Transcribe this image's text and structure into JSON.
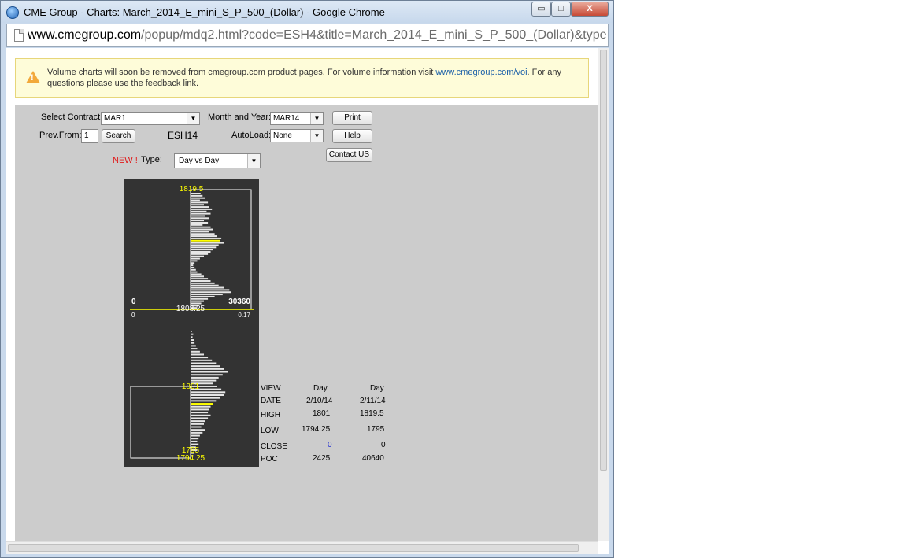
{
  "window": {
    "title": "CME Group - Charts: March_2014_E_mini_S_P_500_(Dollar) - Google Chrome",
    "min_glyph": "▭",
    "max_glyph": "□",
    "close_glyph": "X"
  },
  "address": {
    "host": "www.cmegroup.com",
    "path": "/popup/mdq2.html?code=ESH4&title=March_2014_E_mini_S_P_500_(Dollar)&type="
  },
  "notice": {
    "text_before": "Volume charts will soon be removed from cmegroup.com product pages. For volume information visit ",
    "link": "www.cmegroup.com/voi",
    "text_after": ". For any questions please use the feedback link."
  },
  "controls": {
    "select_contract_label": "Select Contract:",
    "select_contract_value": "MAR1",
    "month_year_label": "Month and Year:",
    "month_year_value": "MAR14",
    "print_label": "Print",
    "prevfrom_label": "Prev.From:",
    "prevfrom_value": "1",
    "search_label": "Search",
    "code_text": "ESH14",
    "autoload_label": "AutoLoad:",
    "autoload_value": "None",
    "help_label": "Help",
    "contact_label": "Contact US",
    "new_label": "NEW !",
    "type_label": "Type:",
    "type_value": "Day vs Day"
  },
  "chart_data": {
    "type": "bar",
    "orientation": "horizontal",
    "description_source": "volume profile, two sessions stacked",
    "colors": {
      "background": "#333333",
      "bars": "#e6e6e6",
      "poc": "#ffff00",
      "box": "#ffffff",
      "price_label": "#ffff00",
      "axis_text": "#ffffff"
    },
    "max_volume": 30360,
    "upper_profile": {
      "high": "1819.5",
      "low": "1808.25",
      "bars": [
        0.15,
        0.18,
        0.22,
        0.14,
        0.26,
        0.2,
        0.28,
        0.32,
        0.24,
        0.3,
        0.22,
        0.28,
        0.2,
        0.26,
        0.18,
        0.3,
        0.34,
        0.28,
        0.36,
        0.4,
        0.46,
        0.44,
        0.5,
        0.42,
        0.38,
        0.34,
        0.3,
        0.26,
        0.2,
        0.14,
        0.1,
        0.06,
        0.04,
        0.06,
        0.08,
        0.1,
        0.16,
        0.2,
        0.26,
        0.3,
        0.36,
        0.42,
        0.5,
        0.58,
        0.6,
        0.48,
        0.36,
        0.26,
        0.2,
        0.16,
        0.12,
        0.1
      ],
      "poc_index": 21
    },
    "lower_profile": {
      "high": "1801",
      "low_a": "1795",
      "low_b": "1794.25",
      "bars": [
        0.02,
        0.04,
        0.03,
        0.05,
        0.06,
        0.08,
        0.1,
        0.14,
        0.2,
        0.26,
        0.32,
        0.38,
        0.44,
        0.5,
        0.56,
        0.48,
        0.42,
        0.38,
        0.34,
        0.4,
        0.46,
        0.52,
        0.5,
        0.44,
        0.38,
        0.34,
        0.3,
        0.28,
        0.26,
        0.3,
        0.26,
        0.22,
        0.2,
        0.16,
        0.22,
        0.18,
        0.14,
        0.12,
        0.1,
        0.12,
        0.08,
        0.1,
        0.06,
        0.04
      ],
      "poc_index": 25
    },
    "axis": {
      "left_volume": "0",
      "right_volume": "30360",
      "left_pct": "0",
      "right_pct": "0.17",
      "middle_price": "1808.25"
    }
  },
  "stats": {
    "headers": [
      "VIEW",
      "Day",
      "Day"
    ],
    "rows": [
      {
        "label": "DATE",
        "a": "2/10/14",
        "b": "2/11/14"
      },
      {
        "label": "HIGH",
        "a": "1801",
        "b": "1819.5"
      },
      {
        "label": "LOW",
        "a": "1794.25",
        "b": "1795"
      },
      {
        "label": "CLOSE",
        "a": "0",
        "b": "0"
      },
      {
        "label": "POC",
        "a": "2425",
        "b": "40640"
      }
    ],
    "close_a_color": "#1f2bd1"
  }
}
